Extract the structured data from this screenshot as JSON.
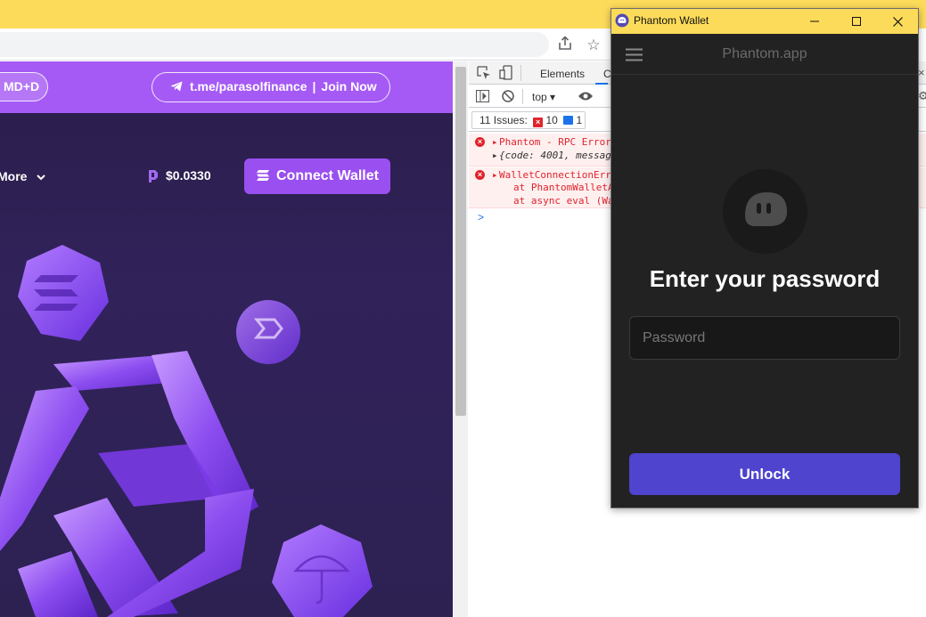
{
  "browser": {
    "share_icon": "share-icon",
    "star_icon": "star-icon"
  },
  "site": {
    "banner": {
      "shortcut_pill": "MD+D",
      "telegram_link": "t.me/parasolfinance",
      "separator": "|",
      "join_label": "Join Now"
    },
    "nav": {
      "more_label": "More",
      "price": "$0.0330",
      "connect_label": "Connect Wallet"
    },
    "colors": {
      "banner": "#a55af5",
      "connect": "#9a4ff0",
      "background": "#2a1d49"
    }
  },
  "devtools": {
    "tabs": {
      "elements": "Elements",
      "console_partial": "C"
    },
    "toolbar": {
      "context": "top"
    },
    "issues": {
      "label": "11 Issues:",
      "errors": "10",
      "info": "1"
    },
    "log": [
      {
        "line1": "Phantom - RPC Error",
        "line2": "{code: 4001, messag"
      },
      {
        "line1": "WalletConnectionErr",
        "line2": "at PhantomWalletA",
        "line3": "at async eval (Wa"
      }
    ],
    "prompt": ">"
  },
  "phantom": {
    "window_title": "Phantom Wallet",
    "site_label": "Phantom.app",
    "heading": "Enter your password",
    "password_placeholder": "Password",
    "unlock_label": "Unlock",
    "colors": {
      "button": "#4e44ce",
      "panel": "#222222",
      "titlebar": "#fddb5a"
    }
  }
}
